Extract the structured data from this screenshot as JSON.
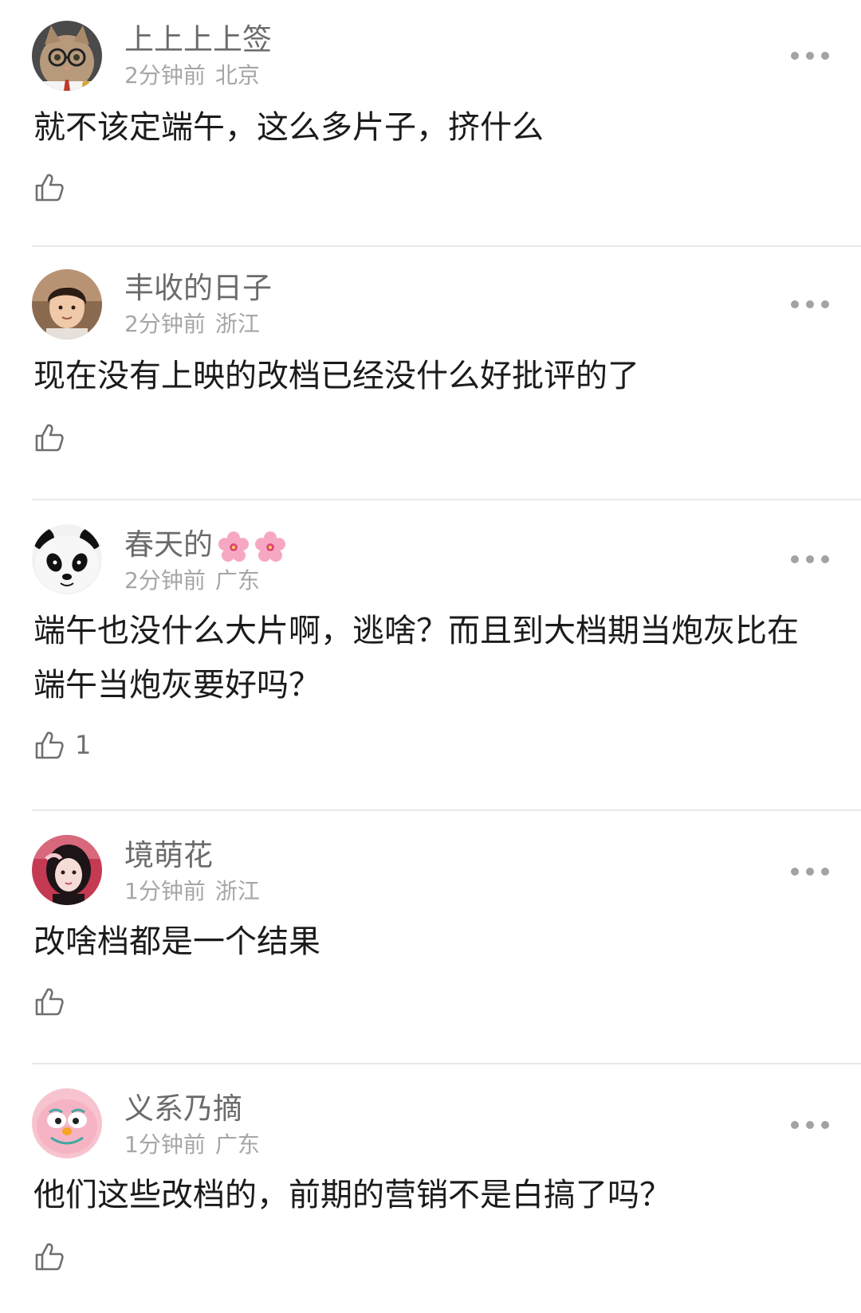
{
  "comments": [
    {
      "username": "上上上上签",
      "time": "2分钟前",
      "location": "北京",
      "text": "就不该定端午，这么多片子，挤什么",
      "likes": "",
      "avatar_icon": "cat-with-glasses-avatar"
    },
    {
      "username": "丰收的日子",
      "time": "2分钟前",
      "location": "浙江",
      "text": "现在没有上映的改档已经没什么好批评的了",
      "likes": "",
      "avatar_icon": "person-photo-avatar"
    },
    {
      "username": "春天的",
      "username_emoji": [
        "cherry-blossom-icon",
        "cherry-blossom-icon"
      ],
      "time": "2分钟前",
      "location": "广东",
      "text": "端午也没什么大片啊，逃啥？而且到大档期当炮灰比在端午当炮灰要好吗？",
      "likes": "1",
      "avatar_icon": "panda-avatar"
    },
    {
      "username": "境萌花",
      "time": "1分钟前",
      "location": "浙江",
      "text": "改啥档都是一个结果",
      "likes": "",
      "avatar_icon": "girl-photo-avatar"
    },
    {
      "username": "义系乃摘",
      "time": "1分钟前",
      "location": "广东",
      "text": "他们这些改档的，前期的营销不是白搞了吗？",
      "likes": "",
      "avatar_icon": "pink-cartoon-avatar"
    }
  ],
  "colors": {
    "username": "#6b6b6b",
    "meta": "#a6a6a6",
    "text": "#1b1b1b",
    "divider": "#e9e9e9",
    "icon": "#6f6f6f"
  }
}
